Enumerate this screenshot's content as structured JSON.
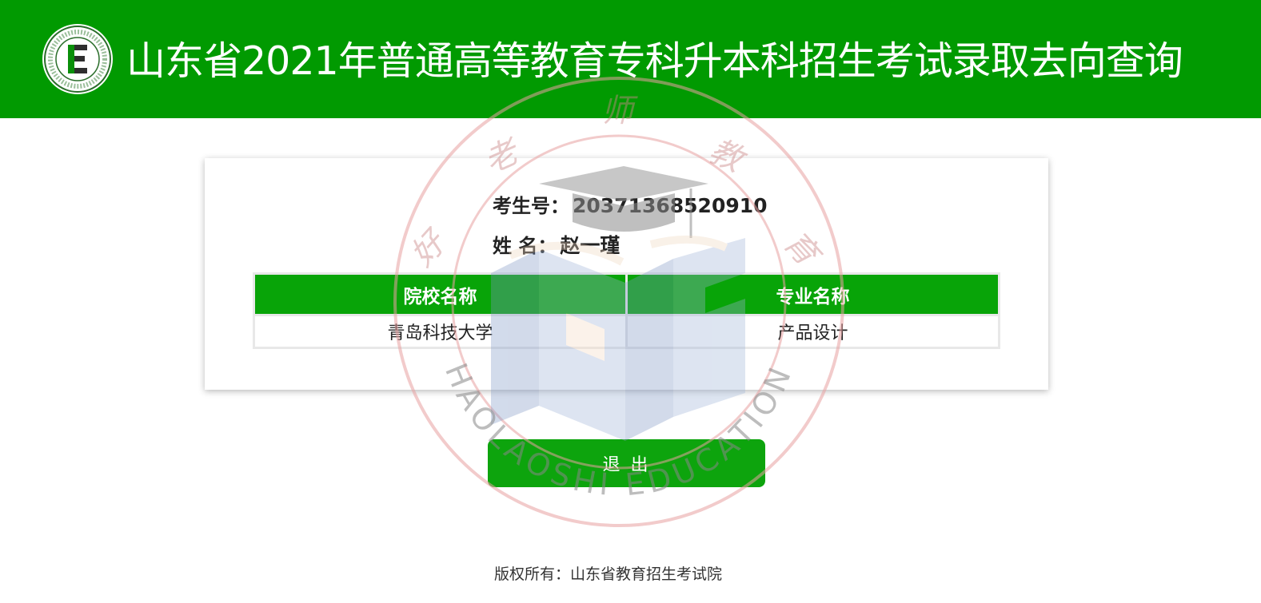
{
  "header": {
    "title": "山东省2021年普通高等教育专科升本科招生考试录取去向查询",
    "logo_icon": "exam-authority-emblem-icon",
    "background_color": "#019a01"
  },
  "candidate": {
    "id_label": "考生号：",
    "id_value": "20371368520910",
    "name_label": "姓 名：",
    "name_value": "赵一瑾"
  },
  "results": {
    "columns": [
      "院校名称",
      "专业名称"
    ],
    "rows": [
      {
        "school": "青岛科技大学",
        "major": "产品设计"
      }
    ],
    "header_color": "#08a408"
  },
  "actions": {
    "logout_label": "退 出",
    "button_color": "#0da40d"
  },
  "footer": {
    "copyright": "版权所有：山东省教育招生考试院"
  },
  "watermark": {
    "text_cn": [
      "好",
      "老",
      "师",
      "教",
      "育"
    ],
    "text_en": "HAOLAOSHI EDUCATION",
    "icon": "graduation-cap-icon",
    "ring_color": "#e8a0a0"
  }
}
